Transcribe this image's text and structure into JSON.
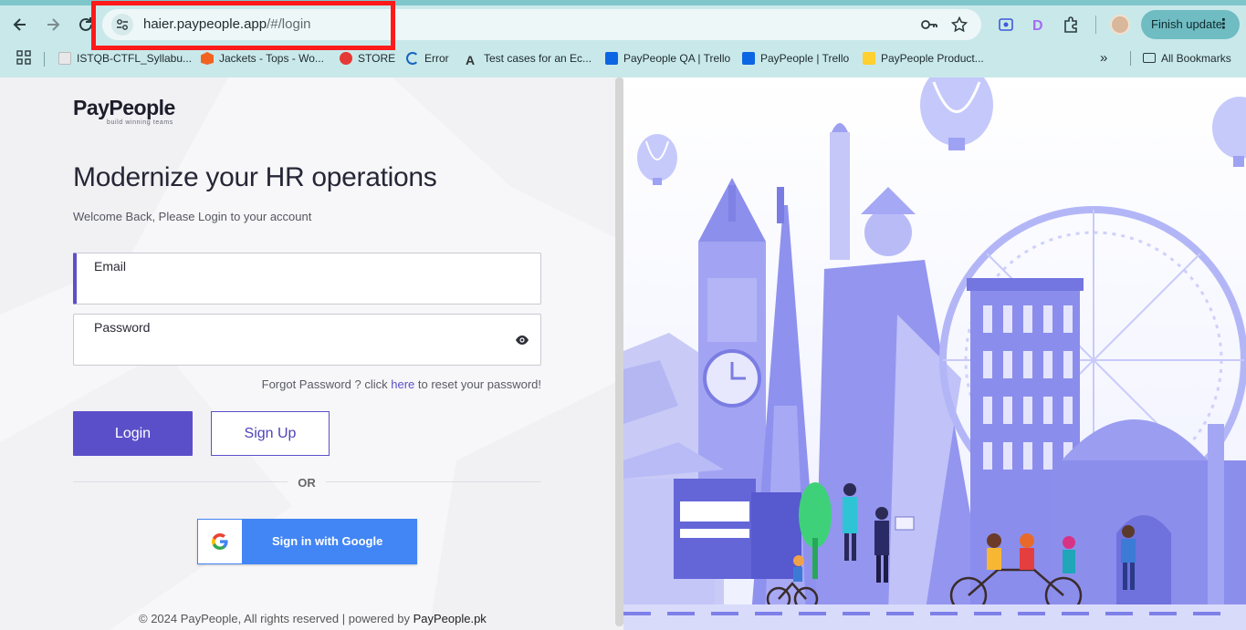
{
  "browser": {
    "url_host": "haier.paypeople.app",
    "url_path": "/#/login",
    "finish_update_label": "Finish update",
    "bookmarks": [
      {
        "label": "ISTQB-CTFL_Syllabu...",
        "icon": "istqb-icon",
        "color": "#e6e6e6"
      },
      {
        "label": "Jackets - Tops - Wo...",
        "icon": "magento-icon",
        "color": "#f26322"
      },
      {
        "label": "STORE",
        "icon": "store-icon",
        "color": "#e53935"
      },
      {
        "label": "Error",
        "icon": "error-spinner-icon",
        "color": "#1565c0"
      },
      {
        "label": "Test cases for an Ec...",
        "icon": "a-letter-icon",
        "color": "#333333"
      },
      {
        "label": "PayPeople QA | Trello",
        "icon": "trello-icon",
        "color": "#0c66e4"
      },
      {
        "label": "PayPeople | Trello",
        "icon": "trello-icon",
        "color": "#0c66e4"
      },
      {
        "label": "PayPeople Product...",
        "icon": "miro-icon",
        "color": "#ffd02f"
      }
    ],
    "all_bookmarks_label": "All Bookmarks"
  },
  "login": {
    "logo_text": "PayPeople",
    "logo_tagline": "build winning teams",
    "headline": "Modernize your HR operations",
    "subtitle": "Welcome Back, Please Login to your account",
    "email_label": "Email",
    "email_value": "",
    "password_label": "Password",
    "password_value": "",
    "forgot_prefix": "Forgot Password ? click ",
    "forgot_link": "here",
    "forgot_suffix": " to reset your password!",
    "login_button": "Login",
    "signup_button": "Sign Up",
    "or_text": "OR",
    "google_button": "Sign in with Google",
    "footer_text": "© 2024 PayPeople, All rights reserved | powered by ",
    "footer_brand": "PayPeople.pk"
  },
  "colors": {
    "primary": "#5b4fc9",
    "google_blue": "#4285f4",
    "illustration": "#8e8df0",
    "highlight": "#ff1a1a"
  }
}
